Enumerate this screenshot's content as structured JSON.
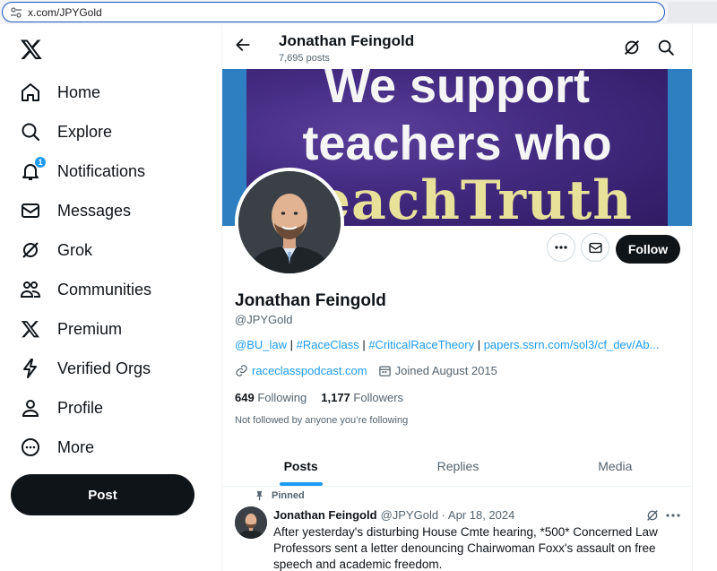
{
  "browser": {
    "url": "x.com/JPYGold"
  },
  "nav": {
    "items": [
      {
        "label": "Home",
        "icon": "home-icon"
      },
      {
        "label": "Explore",
        "icon": "search-icon"
      },
      {
        "label": "Notifications",
        "icon": "bell-icon",
        "badge": "1"
      },
      {
        "label": "Messages",
        "icon": "envelope-icon"
      },
      {
        "label": "Grok",
        "icon": "grok-icon"
      },
      {
        "label": "Communities",
        "icon": "people-icon"
      },
      {
        "label": "Premium",
        "icon": "x-logo-icon"
      },
      {
        "label": "Verified Orgs",
        "icon": "lightning-icon"
      },
      {
        "label": "Profile",
        "icon": "person-icon"
      },
      {
        "label": "More",
        "icon": "more-circle-icon"
      }
    ],
    "post_label": "Post"
  },
  "header": {
    "name": "Jonathan Feingold",
    "posts_count": "7,695 posts"
  },
  "banner": {
    "line1": "We support",
    "line2": "teachers who",
    "line3": "TeachTruth"
  },
  "profile": {
    "name": "Jonathan Feingold",
    "handle": "@JPYGold",
    "bio": {
      "link1": "@BU_law",
      "sep1": " | ",
      "link2": "#RaceClass",
      "sep2": " | ",
      "link3": "#CriticalRaceTheory",
      "sep3": " | ",
      "link4": "papers.ssrn.com/sol3/cf_dev/Ab..."
    },
    "website": "raceclasspodcast.com",
    "joined": "Joined August 2015",
    "following_count": "649",
    "following_label": "Following",
    "followers_count": "1,177",
    "followers_label": "Followers",
    "not_followed": "Not followed by anyone you’re following",
    "follow_label": "Follow"
  },
  "tabs": [
    {
      "label": "Posts",
      "active": true
    },
    {
      "label": "Replies",
      "active": false
    },
    {
      "label": "Media",
      "active": false
    }
  ],
  "tweet": {
    "pinned_label": "Pinned",
    "author": "Jonathan Feingold",
    "meta": "@JPYGold · Apr 18, 2024",
    "text": "After yesterday's disturbing House Cmte hearing, *500* Concerned Law Professors sent a letter denouncing Chairwoman Foxx's assault on free speech and academic freedom."
  },
  "colors": {
    "accent": "#1d9bf0",
    "text": "#0f1419",
    "muted": "#536471",
    "dark_button": "#0f1419"
  }
}
